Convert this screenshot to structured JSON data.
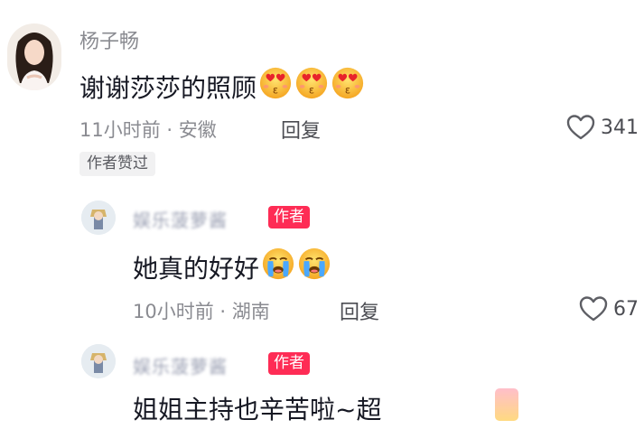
{
  "comment": {
    "username": "杨子畅",
    "text": "谢谢莎莎的照顾",
    "emoji_count": 3,
    "time": "11小时前",
    "dot": "·",
    "location": "安徽",
    "reply_label": "回复",
    "likes": "341",
    "author_liked_tag": "作者赞过"
  },
  "replies": [
    {
      "username": "娱乐菠萝酱",
      "badge": "作者",
      "text": "她真的好好",
      "time": "10小时前",
      "dot": "·",
      "location": "湖南",
      "reply_label": "回复",
      "likes": "67"
    },
    {
      "username": "娱乐菠萝酱",
      "badge": "作者",
      "text": "姐姐主持也辛苦啦~超"
    }
  ],
  "icons": {
    "heart_eyes": "heart-eyes-emoji",
    "crying": "crying-emoji",
    "like": "heart-outline-icon"
  },
  "colors": {
    "badge_red": "#fe2c55",
    "meta_gray": "#8a8b91"
  }
}
